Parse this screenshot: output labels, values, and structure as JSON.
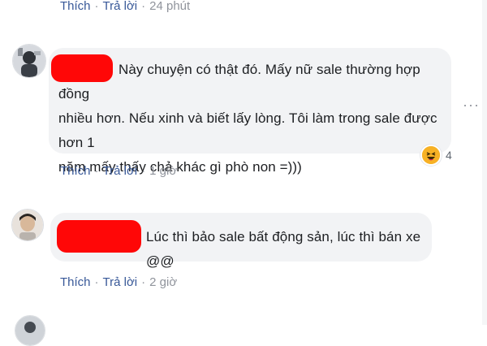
{
  "top_actions": {
    "like": "Thích",
    "reply": "Trả lời",
    "time": "24 phút"
  },
  "comments": [
    {
      "text_lines": [
        "Này chuyện có thật đó. Mấy nữ sale thường hợp đồng",
        "nhiều hơn. Nếu xinh và biết lấy lòng. Tôi làm trong sale được hơn 1",
        "năm mấy thấy chả khác gì phò non =)))"
      ],
      "reaction_count": "4",
      "reaction_icon": "haha-emoji-icon",
      "actions": {
        "like": "Thích",
        "reply": "Trả lời",
        "time": "1 giờ"
      }
    },
    {
      "text_lines": [
        "Lúc thì bảo sale bất động sản, lúc thì bán xe @@"
      ],
      "actions": {
        "like": "Thích",
        "reply": "Trả lời",
        "time": "2 giờ"
      }
    }
  ],
  "colors": {
    "link": "#385898",
    "muted": "#90949c",
    "bubble": "#f2f3f5",
    "redaction": "#ff0707"
  }
}
